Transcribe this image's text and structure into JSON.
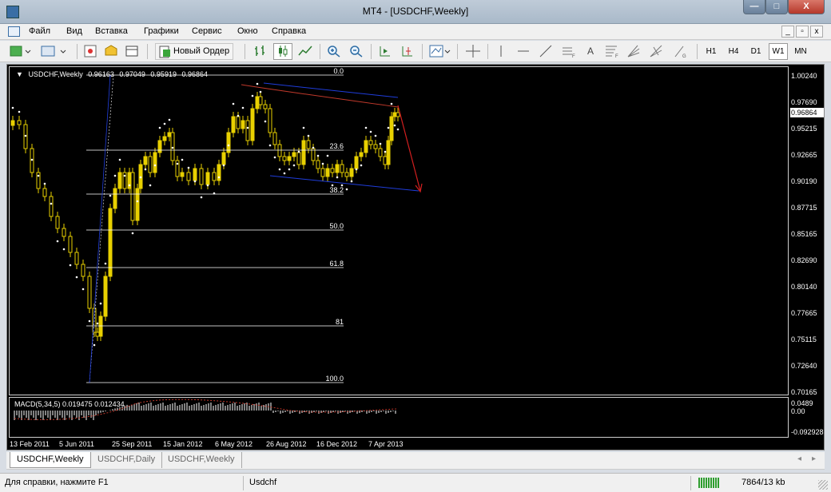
{
  "window": {
    "title": "MT4 - [USDCHF,Weekly]",
    "buttons": {
      "minimize": "—",
      "maximize": "□",
      "close": "X"
    }
  },
  "menu": {
    "items": [
      "Файл",
      "Вид",
      "Вставка",
      "Графики",
      "Сервис",
      "Окно",
      "Справка"
    ],
    "mdi_buttons": {
      "minimize": "_",
      "restore": "▫",
      "close": "x"
    }
  },
  "toolbar": {
    "new_order_label": "Новый Ордер",
    "text_tool_label": "A",
    "timeframes": [
      "H1",
      "H4",
      "D1",
      "W1",
      "MN"
    ],
    "active_timeframe": "W1"
  },
  "chart": {
    "symbol_period": "USDCHF,Weekly",
    "ohlc": [
      "0.96163",
      "0.97049",
      "0.95919",
      "0.96864"
    ],
    "current_price": "0.96864",
    "price_axis": [
      "1.00240",
      "0.97690",
      "0.95215",
      "0.92665",
      "0.90190",
      "0.87715",
      "0.85165",
      "0.82690",
      "0.80140",
      "0.77665",
      "0.75115",
      "0.72640",
      "0.70165"
    ],
    "time_axis": [
      "13 Feb 2011",
      "5 Jun 2011",
      "25 Sep 2011",
      "15 Jan 2012",
      "6 May 2012",
      "26 Aug 2012",
      "16 Dec 2012",
      "7 Apr 2013"
    ],
    "fib_levels": [
      "0.0",
      "23.6",
      "38.2",
      "50.0",
      "61.8",
      "81",
      "100.0"
    ],
    "colors": {
      "background": "#000000",
      "bull_candle": "#e8d000",
      "bear_candle": "#e8d000",
      "parabolic_sar": "#ffffff",
      "moving_average": "#c0392b",
      "trend_channel": "#1f3ddb",
      "projection_arrow": "#d21f1f",
      "fib_lines": "#ffffff"
    }
  },
  "macd": {
    "label": "MACD(5,34,5)",
    "values": [
      "0.019475",
      "0.012434"
    ],
    "axis": [
      "0.0489",
      "0.00",
      "-0.092928"
    ]
  },
  "tabs": [
    "USDCHF,Weekly",
    "USDCHF,Daily",
    "USDCHF,Weekly"
  ],
  "active_tab": 0,
  "tab_scroll": {
    "left": "◂",
    "right": "▸"
  },
  "status": {
    "help": "Для справки, нажмите F1",
    "profile": "Usdchf",
    "traffic": "7864/13 kb"
  }
}
